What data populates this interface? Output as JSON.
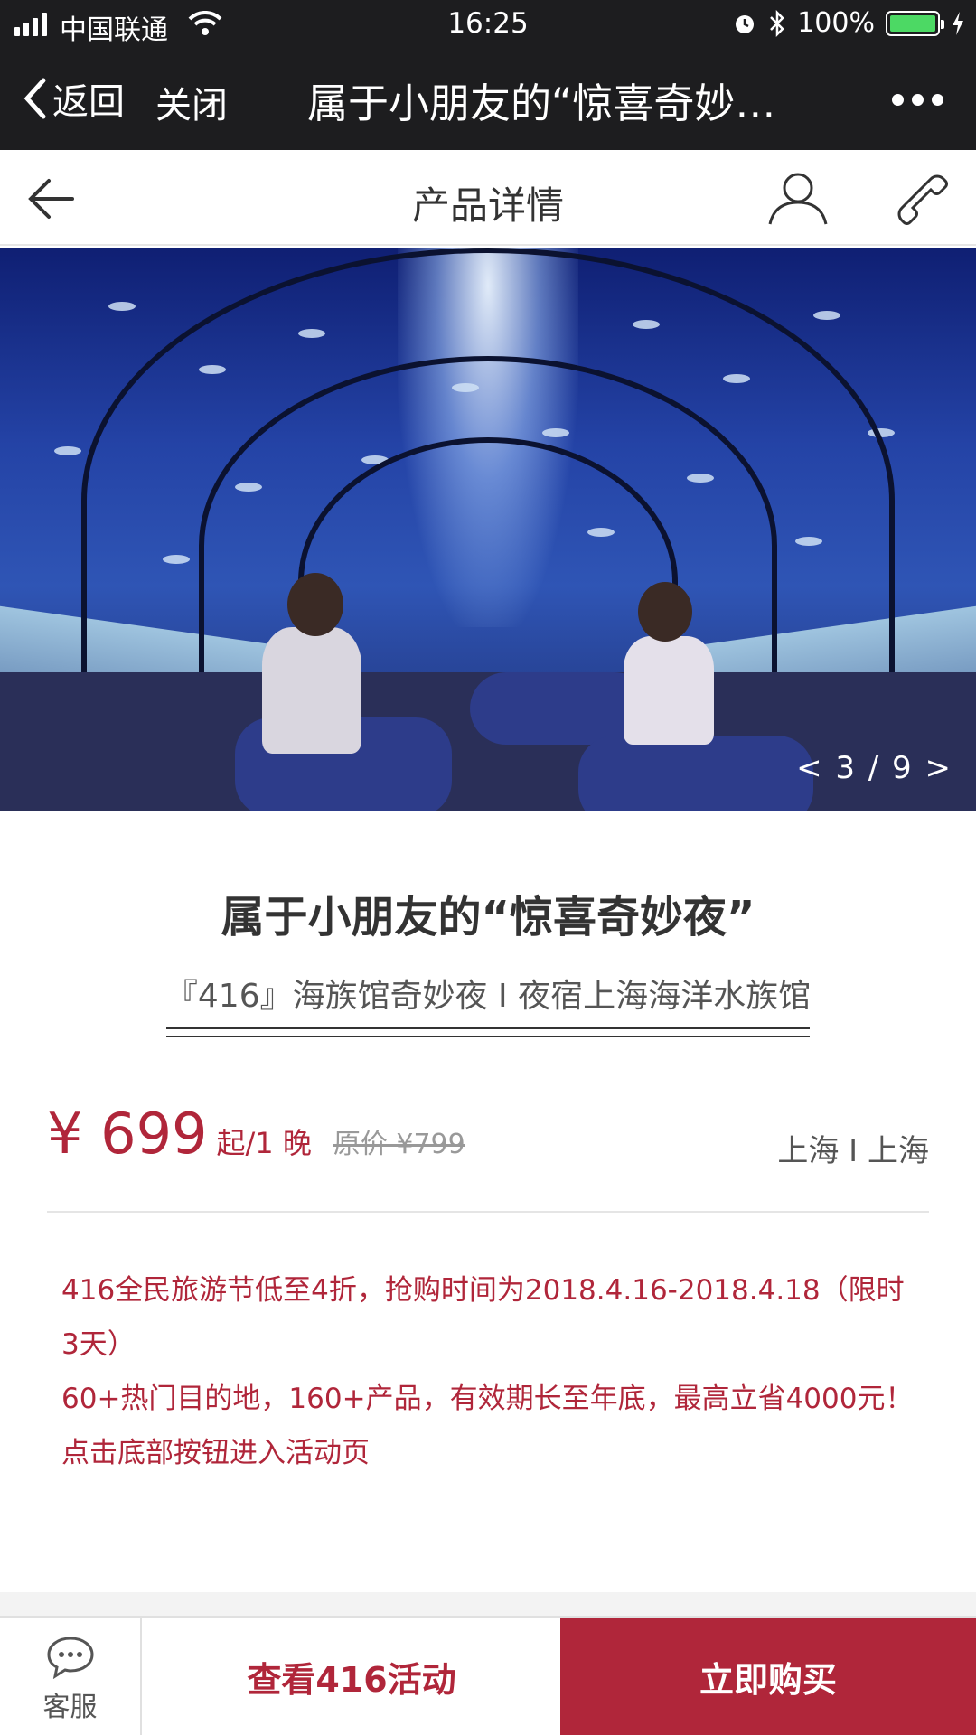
{
  "status_bar": {
    "carrier": "中国联通",
    "time": "16:25",
    "battery": "100%"
  },
  "wechat_nav": {
    "back_label": "返回",
    "close_label": "关闭",
    "title": "属于小朋友的“惊喜奇妙…"
  },
  "page_header": {
    "title": "产品详情"
  },
  "hero": {
    "counter": "< 3 / 9 >"
  },
  "product": {
    "title": "属于小朋友的“惊喜奇妙夜”",
    "subtitle": "『416』海族馆奇妙夜 I 夜宿上海海洋水族馆",
    "price": "¥ 699",
    "price_unit": "起/1 晚",
    "original_price": "原价 ¥799",
    "location": "上海 I 上海"
  },
  "promo": {
    "lines": [
      "416全民旅游节低至4折，抢购时间为2018.4.16-2018.4.18（限时3天）",
      "60+热门目的地，160+产品，有效期长至年底，最高立省4000元！",
      "点击底部按钮进入活动页"
    ]
  },
  "bottom_bar": {
    "service_label": "客服",
    "activity_button": "查看416活动",
    "buy_button": "立即购买"
  },
  "colors": {
    "accent": "#b0263a",
    "topbar": "#1d1d1f",
    "battery": "#4cd964"
  },
  "icons": [
    "signal-icon",
    "wifi-icon",
    "alarm-icon",
    "bluetooth-icon",
    "battery-icon",
    "charging-icon",
    "back-chevron-icon",
    "more-icon",
    "arrow-left-icon",
    "user-icon",
    "phone-icon",
    "chat-bubble-icon"
  ]
}
